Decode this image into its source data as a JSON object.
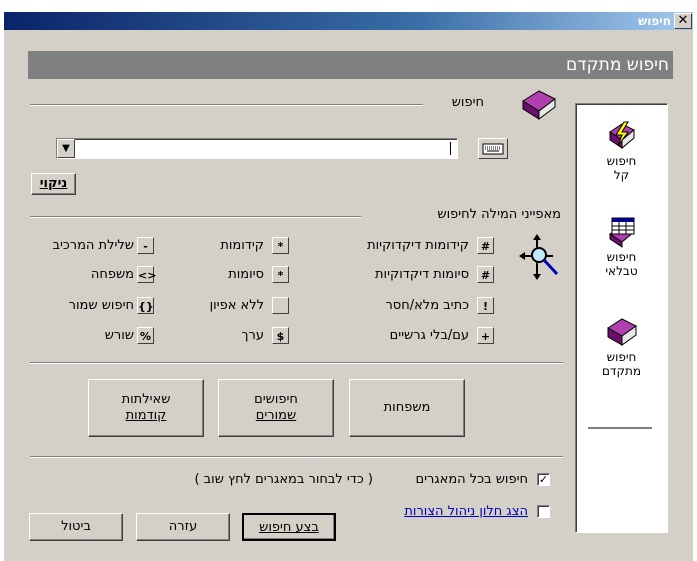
{
  "window": {
    "title": "חיפוש",
    "close_label": "✕"
  },
  "banner": {
    "title": "חיפוש מתקדם"
  },
  "search_section": {
    "label": "חיפוש",
    "input_value": "",
    "clear_label": "ניקוי"
  },
  "properties": {
    "label": "מאפייני המילה לחיפוש",
    "col1": [
      {
        "sym": "#",
        "label": "קידומות דיקדוקיות"
      },
      {
        "sym": "#",
        "label": "סיומות דיקדוקיות"
      },
      {
        "sym": "!",
        "label": "כתיב מלא/חסר"
      },
      {
        "sym": "+",
        "label": "עם/בלי גרשיים"
      }
    ],
    "col2": [
      {
        "sym": "*",
        "label": "קידומות"
      },
      {
        "sym": "*",
        "label": "סיומות"
      },
      {
        "sym": "",
        "label": "ללא אפיון"
      },
      {
        "sym": "$",
        "label": "ערך"
      }
    ],
    "col3": [
      {
        "sym": "-",
        "label": "שלילת המרכיב"
      },
      {
        "sym": "<>",
        "label": "משפחה"
      },
      {
        "sym": "{}",
        "label": "חיפוש שמור"
      },
      {
        "sym": "%",
        "label": "שורש"
      }
    ]
  },
  "big_buttons": {
    "families": "משפחות",
    "saved_line1": "חיפושים",
    "saved_line2": "שמורים",
    "previous_line1": "שאילתות",
    "previous_line2": "קודמות"
  },
  "options": {
    "all_databases_label": "חיפוש בכל המאגרים",
    "all_databases_checked": true,
    "all_databases_hint": "( כדי לבחור במאגרים לחץ שוב )",
    "show_attachments_label": "הצג חלון ניהול הצורות",
    "show_attachments_checked": false
  },
  "footer": {
    "run_label": "בצע חיפוש",
    "help_label": "עזרה",
    "cancel_label": "ביטול"
  },
  "sidebar": {
    "items": [
      {
        "line1": "חיפוש",
        "line2": "קל",
        "icon": "lightning-book-icon"
      },
      {
        "line1": "חיפוש",
        "line2": "טבלאי",
        "icon": "table-book-icon"
      },
      {
        "line1": "חיפוש",
        "line2": "מתקדם",
        "icon": "purple-book-icon"
      }
    ]
  },
  "colors": {
    "dialog_bg": "#d4d0c8",
    "banner_bg": "#808080",
    "book": "#8b1a8b",
    "link": "#0000c0"
  }
}
